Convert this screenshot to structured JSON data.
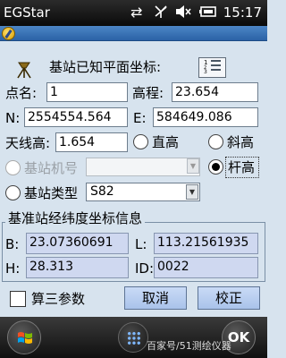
{
  "status_bar": {
    "app_title": "EGStar",
    "time": "15:17",
    "icons": [
      "sync-arrows-icon",
      "no-signal-icon",
      "speaker-muted-icon",
      "battery-icon"
    ]
  },
  "toolbar": {
    "logo": "egstar-logo"
  },
  "form": {
    "section_title": "基站已知平面坐标:",
    "point_name": {
      "label": "点名:",
      "value": "1"
    },
    "elevation": {
      "label": "高程:",
      "value": "23.654"
    },
    "north": {
      "label": "N:",
      "value": "2554554.564"
    },
    "east": {
      "label": "E:",
      "value": "584649.086"
    },
    "antenna_height": {
      "label": "天线高:",
      "value": "1.654"
    },
    "height_modes": {
      "straight": "直高",
      "slant": "斜高",
      "pole": "杆高",
      "selected": "pole"
    },
    "base_serial": {
      "label": "基站机号",
      "value": "",
      "enabled": false
    },
    "base_type": {
      "label": "基站类型",
      "value": "S82"
    }
  },
  "latlon_group": {
    "title": "基准站经纬度坐标信息",
    "b": {
      "label": "B:",
      "value": "23.07360691"
    },
    "l": {
      "label": "L:",
      "value": "113.21561935"
    },
    "h": {
      "label": "H:",
      "value": "28.313"
    },
    "id": {
      "label": "ID:",
      "value": "0022"
    }
  },
  "actions": {
    "three_param_label": "算三参数",
    "three_param_checked": false,
    "cancel_label": "取消",
    "calibrate_label": "校正"
  },
  "taskbar": {
    "ok_label": "OK",
    "watermark": "百家号/51测绘仪器"
  },
  "colors": {
    "form_background": "#d7e3ee",
    "readonly_field": "#cfd8f0",
    "toolbar_blue": "#3a75b8"
  }
}
